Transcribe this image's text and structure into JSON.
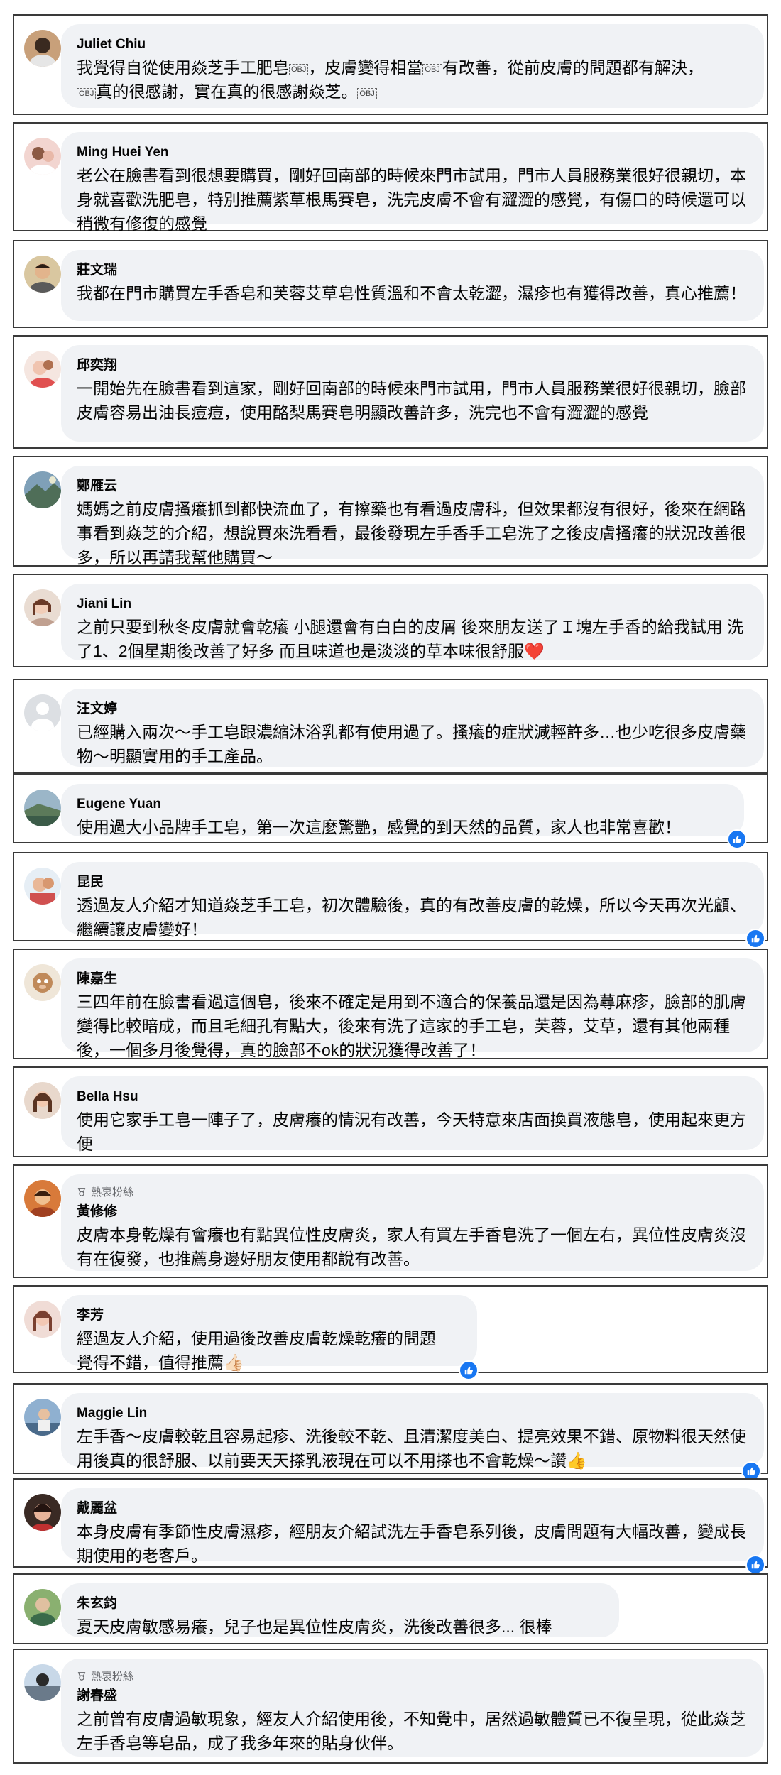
{
  "icons": {
    "badge": "top-fan-badge-icon",
    "reaction": "thumbs-up-reaction-icon",
    "placeholder": "object-replacement-glyph"
  },
  "colors": {
    "bubble": "#f0f2f5",
    "reaction": "#1877f2"
  },
  "comments": [
    {
      "name": "Juliet Chiu",
      "text_1": "我覺得自從使用焱芝手工肥皂",
      "ph_1": "OBJ",
      "text_2": "，皮膚變得相當",
      "ph_2": "OBJ",
      "text_3": "有改善，從前皮膚的問題都有解決，",
      "ph_3": "OBJ",
      "text_4": "真的很感謝，實在真的很感謝焱芝。",
      "ph_4": "OBJ"
    },
    {
      "name": "Ming Huei Yen",
      "text": "老公在臉書看到很想要購買，剛好回南部的時候來門市試用，門市人員服務業很好很親切，本身就喜歡洗肥皂，特別推薦紫草根馬賽皂，洗完皮膚不會有澀澀的感覺，有傷口的時候還可以稍微有修復的感覺"
    },
    {
      "name": "莊文瑞",
      "text": "我都在門市購買左手香皂和芙蓉艾草皂性質溫和不會太乾澀，濕疹也有獲得改善，真心推薦！"
    },
    {
      "name": "邱奕翔",
      "text": "一開始先在臉書看到這家，剛好回南部的時候來門市試用，門市人員服務業很好很親切，臉部皮膚容易出油長痘痘，使用酪梨馬賽皂明顯改善許多，洗完也不會有澀澀的感覺"
    },
    {
      "name": "鄭雁云",
      "text": "媽媽之前皮膚搔癢抓到都快流血了，有擦藥也有看過皮膚科，但效果都沒有很好，後來在網路事看到焱芝的介紹，想說買來洗看看，最後發現左手香手工皂洗了之後皮膚搔癢的狀況改善很多，所以再請我幫他購買～"
    },
    {
      "name": "Jiani Lin",
      "text": "之前只要到秋冬皮膚就會乾癢 小腿還會有白白的皮屑 後來朋友送了Ｉ塊左手香的給我試用 洗了1、2個星期後改善了好多 而且味道也是淡淡的草本味很舒服",
      "emoji": "❤️"
    },
    {
      "name": "汪文婷",
      "text": "已經購入兩次～手工皂跟濃縮沐浴乳都有使用過了。搔癢的症狀減輕許多…也少吃很多皮膚藥物～明顯實用的手工產品。"
    },
    {
      "name": "Eugene Yuan",
      "text": "使用過大小品牌手工皂，第一次這麼驚艷，感覺的到天然的品質，家人也非常喜歡！"
    },
    {
      "name": "昆民",
      "text": "透過友人介紹才知道焱芝手工皂，初次體驗後，真的有改善皮膚的乾燥，所以今天再次光顧、繼續讓皮膚變好！"
    },
    {
      "name": "陳嘉生",
      "text": "三四年前在臉書看過這個皂，後來不確定是用到不適合的保養品還是因為蕁麻疹，臉部的肌膚變得比較暗成，而且毛細孔有點大，後來有洗了這家的手工皂，芙蓉，艾草，還有其他兩種後，一個多月後覺得，真的臉部不ok的狀況獲得改善了！"
    },
    {
      "name": "Bella Hsu",
      "text": "使用它家手工皂一陣子了，皮膚癢的情況有改善，今天特意來店面換買液態皂，使用起來更方便"
    },
    {
      "badge": "熱衷粉絲",
      "name": "黃修修",
      "text": "皮膚本身乾燥有會癢也有點異位性皮膚炎，家人有買左手香皂洗了一個左右，異位性皮膚炎沒有在復發，也推薦身邊好朋友使用都說有改善。"
    },
    {
      "name": "李芳",
      "text_1": "經過友人介紹，使用過後改善皮膚乾燥乾癢的問題",
      "text_2": "覺得不錯，值得推薦",
      "emoji": "👍🏻"
    },
    {
      "name": "Maggie Lin",
      "text": "左手香～皮膚較乾且容易起疹、洗後較不乾、且清潔度美白、提亮效果不錯、原物料很天然使用後真的很舒服、以前要天天搽乳液現在可以不用搽也不會乾燥～讚",
      "emoji": "👍"
    },
    {
      "name": "戴麗盆",
      "text": "本身皮膚有季節性皮膚濕疹，經朋友介紹試洗左手香皂系列後，皮膚問題有大幅改善，變成長期使用的老客戶。"
    },
    {
      "name": "朱玄鈞",
      "text": "夏天皮膚敏感易癢，兒子也是異位性皮膚炎，洗後改善很多... 很棒"
    },
    {
      "badge": "熱衷粉絲",
      "name": "謝春盛",
      "text": "之前曾有皮膚過敏現象，經友人介紹使用後，不知覺中，居然過敏體質已不復呈現，從此焱芝左手香皂等皂品，成了我多年來的貼身伙伴。"
    }
  ]
}
